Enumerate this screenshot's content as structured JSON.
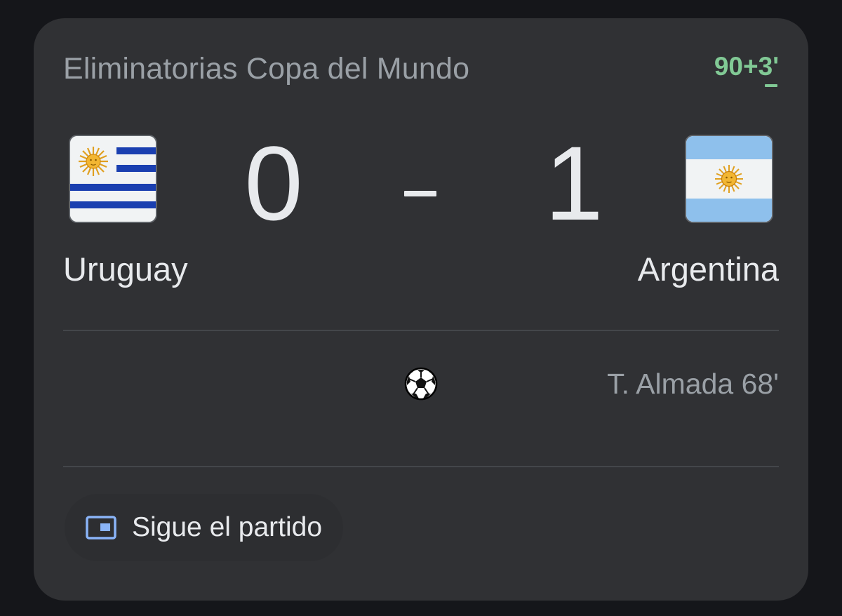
{
  "competition": "Eliminatorias Copa del Mundo",
  "live_time": "90+3'",
  "home": {
    "name": "Uruguay",
    "score": "0",
    "flag_icon": "uruguay-flag-icon"
  },
  "away": {
    "name": "Argentina",
    "score": "1",
    "flag_icon": "argentina-flag-icon"
  },
  "goals": [
    {
      "scorer": "T. Almada 68'",
      "team": "away",
      "icon": "soccer-ball-icon"
    }
  ],
  "follow_button": {
    "label": "Sigue el partido",
    "icon": "picture-in-picture-icon"
  },
  "colors": {
    "card_background": "#303134",
    "page_background": "#15161a",
    "live_green": "#81c995",
    "secondary_text": "#9aa0a6",
    "primary_text": "#e8eaed",
    "icon_blue": "#8ab4f8",
    "uruguay_blue": "#1a3fb0",
    "argentina_blue": "#8ec0ec",
    "sun_gold": "#f2b632"
  }
}
